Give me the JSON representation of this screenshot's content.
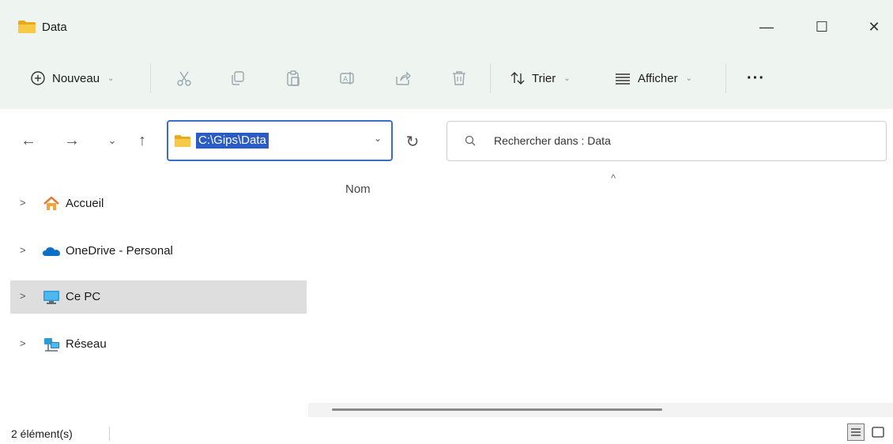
{
  "window": {
    "title": "Data",
    "controls": {
      "minimize": "—",
      "maximize": "☐",
      "close": "✕"
    }
  },
  "toolbar": {
    "new_label": "Nouveau",
    "sort_label": "Trier",
    "view_label": "Afficher",
    "more_label": "···",
    "icons": [
      "plus-circle-icon",
      "cut-icon",
      "copy-icon",
      "paste-icon",
      "rename-icon",
      "share-icon",
      "delete-icon",
      "sort-icon",
      "view-icon"
    ]
  },
  "address": {
    "path": "C:\\Gips\\Data",
    "search_placeholder": "Rechercher dans : Data"
  },
  "sidebar": {
    "items": [
      {
        "label": "Accueil",
        "icon": "home-icon",
        "selected": false
      },
      {
        "label": "OneDrive - Personal",
        "icon": "cloud-icon",
        "selected": false
      },
      {
        "label": "Ce PC",
        "icon": "computer-icon",
        "selected": true
      },
      {
        "label": "Réseau",
        "icon": "network-icon",
        "selected": false
      }
    ]
  },
  "content": {
    "column_name": "Nom"
  },
  "status": {
    "item_count": "2 élément(s)"
  },
  "colors": {
    "accent": "#2b5cc4",
    "titlebar_bg": "#eef5f1",
    "selected_bg": "#dedede",
    "folder_yellow": "#f2c230"
  }
}
